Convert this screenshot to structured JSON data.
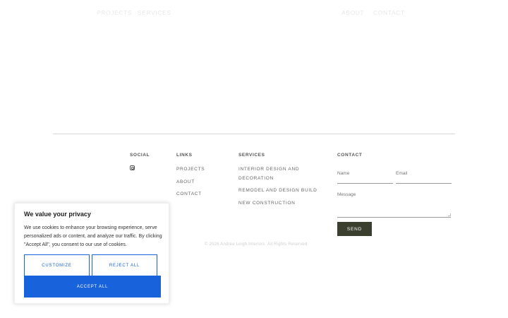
{
  "nav": {
    "projects": "PROJECTS",
    "services": "SERVICES",
    "about": "ABOUT",
    "contact": "CONTACT"
  },
  "footer": {
    "social": {
      "heading": "SOCIAL",
      "icon": "instagram-icon"
    },
    "links": {
      "heading": "LINKS",
      "items": [
        "PROJECTS",
        "ABOUT",
        "CONTACT"
      ]
    },
    "services": {
      "heading": "SERVICES",
      "items": [
        "INTERIOR DESIGN AND",
        "DECORATION",
        "REMODEL AND DESIGN BUILD",
        "NEW CONSTRUCTION"
      ]
    },
    "contact": {
      "heading": "CONTACT",
      "name_label": "Name",
      "email_label": "Email",
      "message_label": "Message",
      "send_label": "SEND"
    },
    "copyright": "© 2026 Andrea Leigh Interiors",
    "rights": "All Rights Reserved"
  },
  "cookie_banner": {
    "title": "We value your privacy",
    "text": "We use cookies to enhance your browsing experience, serve personalized ads or content, and analyze our traffic. By clicking \"Accept All\", you consent to our use of cookies.",
    "customize_label": "CUSTOMIZE",
    "reject_label": "REJECT ALL",
    "accept_label": "ACCEPT ALL"
  },
  "colors": {
    "accent_blue": "#1863dc",
    "send_button": "#3a3f2f"
  }
}
